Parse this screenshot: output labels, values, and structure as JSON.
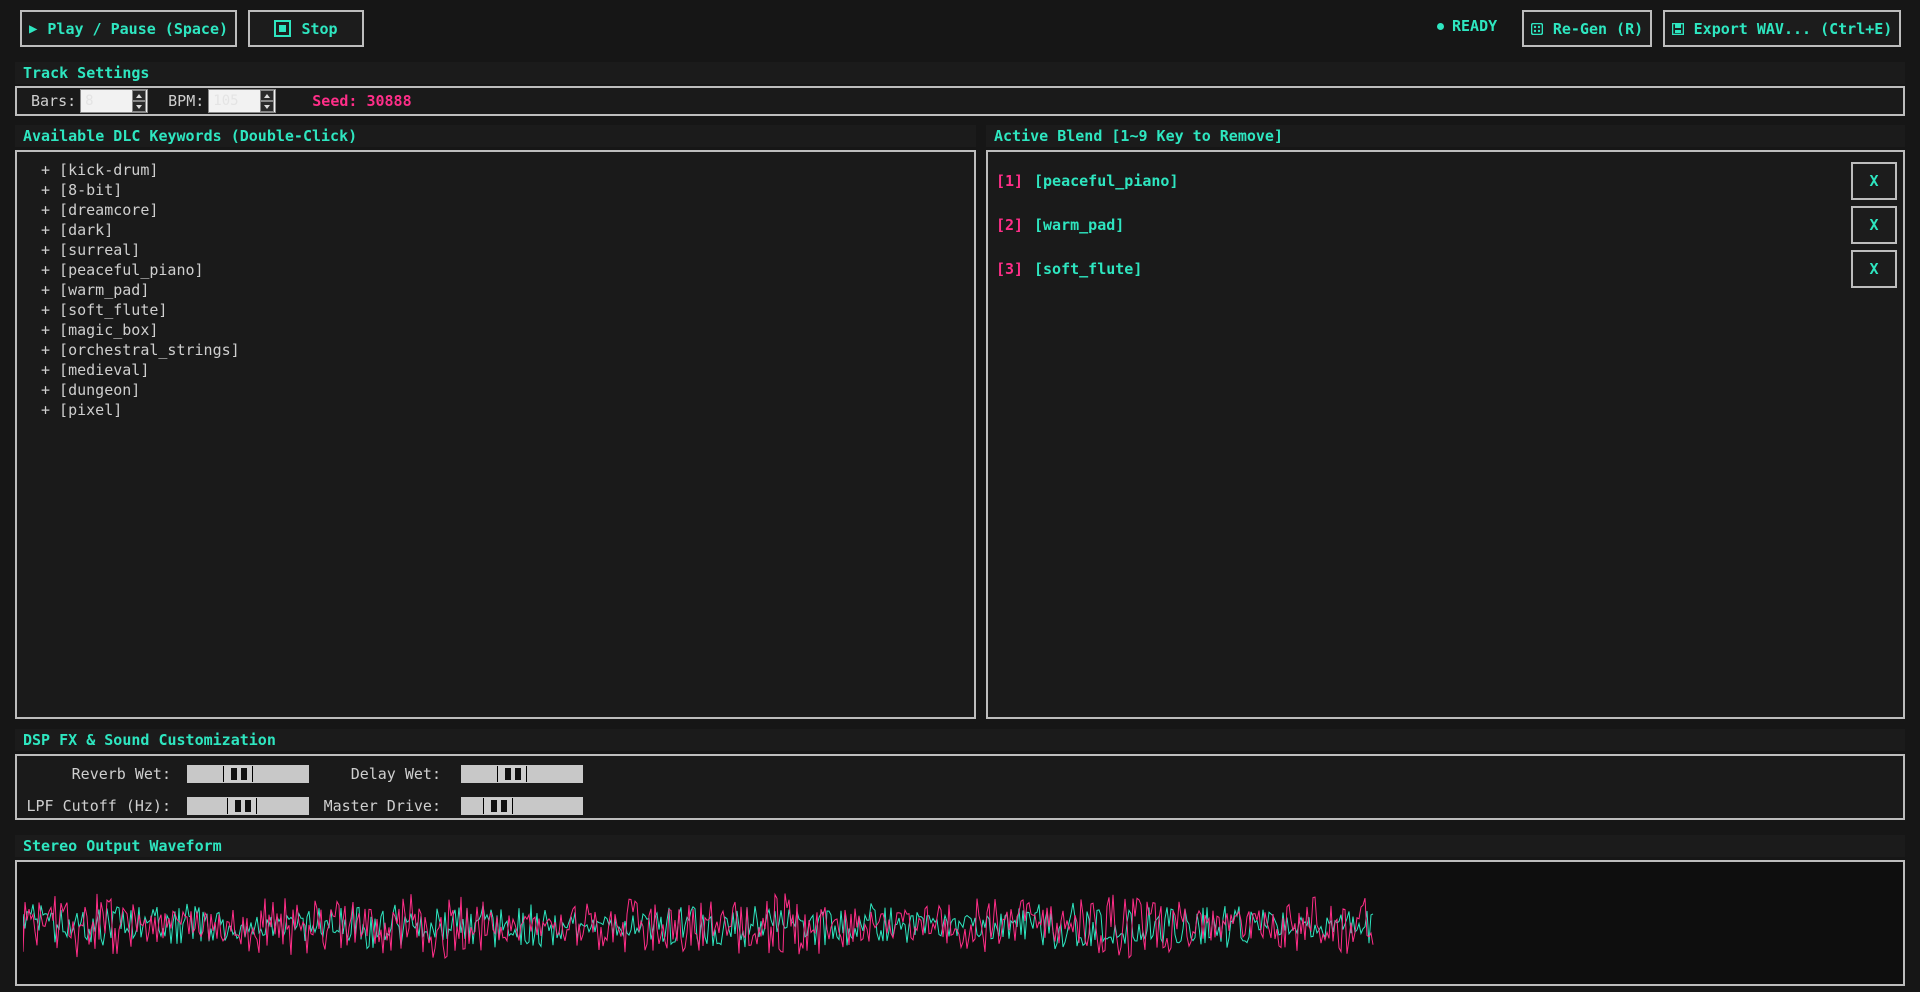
{
  "toolbar": {
    "play_label": "Play / Pause (Space)",
    "stop_label": "Stop",
    "status": "READY",
    "regen_label": "Re-Gen (R)",
    "export_label": "Export WAV... (Ctrl+E)",
    "accent": "#2ee6c0"
  },
  "track_settings": {
    "header": "Track Settings",
    "bars_label": "Bars:",
    "bars_value": "8",
    "bpm_label": "BPM:",
    "bpm_value": "105",
    "seed": "Seed: 30888",
    "seed_color": "#ff2e88"
  },
  "keywords": {
    "header": "Available DLC Keywords (Double-Click)",
    "items": [
      "+ [kick-drum]",
      "+ [8-bit]",
      "+ [dreamcore]",
      "+ [dark]",
      "+ [surreal]",
      "+ [peaceful_piano]",
      "+ [warm_pad]",
      "+ [soft_flute]",
      "+ [magic_box]",
      "+ [orchestral_strings]",
      "+ [medieval]",
      "+ [dungeon]",
      "+ [pixel]"
    ]
  },
  "blend": {
    "header": "Active Blend [1~9 Key to Remove]",
    "items": [
      {
        "index": "[1]",
        "name": "[peaceful_piano]",
        "remove": "X"
      },
      {
        "index": "[2]",
        "name": "[warm_pad]",
        "remove": "X"
      },
      {
        "index": "[3]",
        "name": "[soft_flute]",
        "remove": "X"
      }
    ]
  },
  "dsp": {
    "header": "DSP FX & Sound Customization",
    "reverb_label": "Reverb Wet:",
    "reverb_value": 0.3,
    "delay_label": "Delay Wet:",
    "delay_value": 0.3,
    "lpf_label": "LPF Cutoff (Hz):",
    "lpf_value": 0.35,
    "drive_label": "Master Drive:",
    "drive_value": 0.15
  },
  "waveform": {
    "header": "Stereo Output Waveform",
    "left_color": "#ff2e88",
    "right_color": "#2ee6c0"
  }
}
